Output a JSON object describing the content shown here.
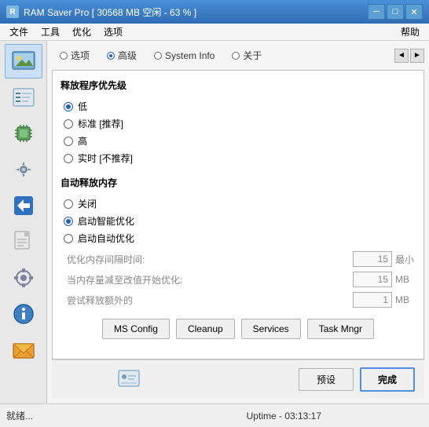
{
  "titlebar": {
    "title": "RAM Saver Pro [ 30568 MB 空闲 - 63 % ]",
    "min_btn": "─",
    "max_btn": "□",
    "close_btn": "✕"
  },
  "menubar": {
    "items": [
      "文件",
      "工具",
      "优化",
      "选项"
    ],
    "help": "帮助"
  },
  "tabs": {
    "items": [
      {
        "label": "选项",
        "active": false
      },
      {
        "label": "高级",
        "active": true
      },
      {
        "label": "System Info",
        "active": false
      },
      {
        "label": "关于",
        "active": false
      }
    ],
    "nav_prev": "◄",
    "nav_next": "►"
  },
  "sections": {
    "priority": {
      "title": "释放程序优先级",
      "options": [
        {
          "label": "低",
          "checked": true
        },
        {
          "label": "标准 [推荐]",
          "checked": false
        },
        {
          "label": "高",
          "checked": false
        },
        {
          "label": "实时 [不推荐]",
          "checked": false
        }
      ]
    },
    "auto_release": {
      "title": "自动释放内存",
      "options": [
        {
          "label": "关闭",
          "checked": false
        },
        {
          "label": "启动智能优化",
          "checked": true
        },
        {
          "label": "启动自动优化",
          "checked": false
        }
      ],
      "fields": [
        {
          "label": "优化内存间隔时间:",
          "value": "15",
          "unit": "最小"
        },
        {
          "label": "当内存量减至改值开始优化:",
          "value": "15",
          "unit": "MB"
        },
        {
          "label": "尝试释放额外的",
          "value": "1",
          "unit": "MB"
        }
      ]
    }
  },
  "action_buttons": [
    {
      "label": "MS Config"
    },
    {
      "label": "Cleanup"
    },
    {
      "label": "Services"
    },
    {
      "label": "Task Mngr"
    }
  ],
  "bottom_buttons": {
    "preset": "预设",
    "done": "完成"
  },
  "statusbar": {
    "left": "就绪...",
    "center": "Uptime - 03:13:17"
  }
}
